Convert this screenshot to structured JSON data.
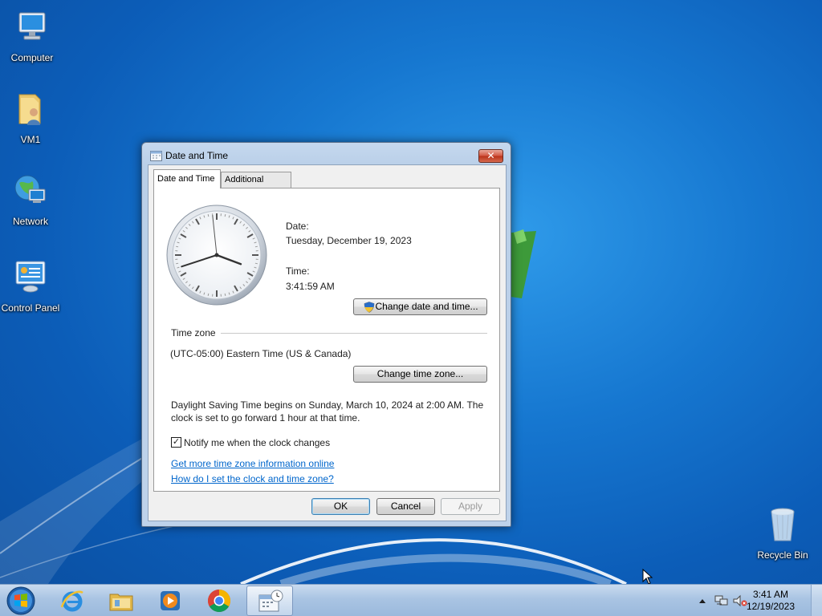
{
  "desktop": {
    "icons": [
      {
        "label": "Computer"
      },
      {
        "label": "VM1"
      },
      {
        "label": "Network"
      },
      {
        "label": "Control Panel"
      },
      {
        "label": "Recycle Bin"
      }
    ]
  },
  "dialog": {
    "title": "Date and Time",
    "tabs": [
      {
        "label": "Date and Time",
        "active": true
      },
      {
        "label": "Additional Clocks",
        "active": false
      }
    ],
    "clock": {
      "hours": 3,
      "minutes": 41,
      "seconds": 59
    },
    "date_label": "Date:",
    "date_value": "Tuesday, December 19, 2023",
    "time_label": "Time:",
    "time_value": "3:41:59 AM",
    "change_datetime_button": "Change date and time...",
    "timezone_heading": "Time zone",
    "timezone_value": "(UTC-05:00) Eastern Time (US & Canada)",
    "change_timezone_button": "Change time zone...",
    "dst_line1": "Daylight Saving Time begins on Sunday, March 10, 2024 at 2:00 AM. The",
    "dst_line2": "clock is set to go forward 1 hour at that time.",
    "notify_checkbox": {
      "label": "Notify me when the clock changes",
      "checked": true
    },
    "link_more_info": "Get more time zone information online",
    "link_how_set": "How do I set the clock and time zone?",
    "ok_button": "OK",
    "cancel_button": "Cancel",
    "apply_button": "Apply"
  },
  "taskbar": {
    "pinned": [
      "internet-explorer-icon",
      "explorer-folder-icon",
      "media-player-icon",
      "chrome-icon",
      "date-time-icon"
    ],
    "clock_time": "3:41 AM",
    "clock_date": "12/19/2023"
  },
  "colors": {
    "desktop_bg": "#1677d0",
    "link": "#0066cc",
    "close_button": "#c94a32"
  }
}
